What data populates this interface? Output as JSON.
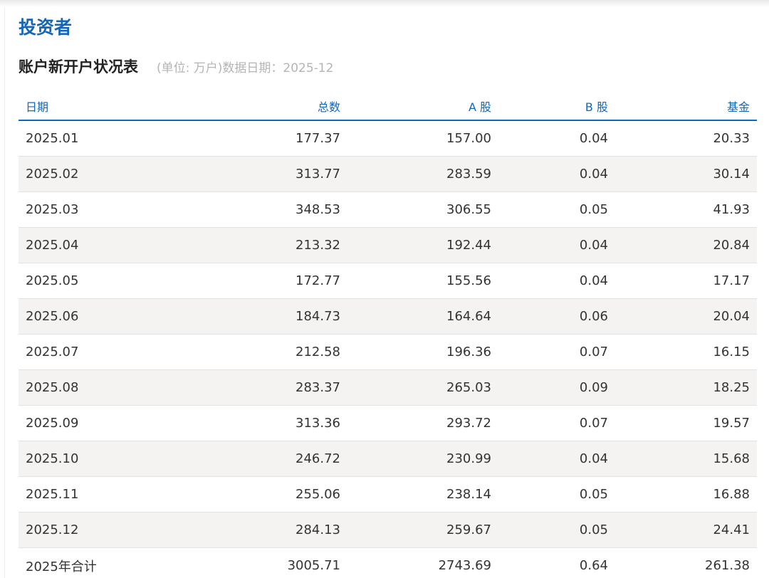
{
  "section": {
    "title": "投资者"
  },
  "table": {
    "name": "账户新开户状况表",
    "unit_note": "(单位: 万户)数据日期：2025-12",
    "headers": {
      "date": "日期",
      "total": "总数",
      "a_share": "A 股",
      "b_share": "B 股",
      "fund": "基金"
    },
    "rows": [
      {
        "date": "2025.01",
        "total": "177.37",
        "a_share": "157.00",
        "b_share": "0.04",
        "fund": "20.33"
      },
      {
        "date": "2025.02",
        "total": "313.77",
        "a_share": "283.59",
        "b_share": "0.04",
        "fund": "30.14"
      },
      {
        "date": "2025.03",
        "total": "348.53",
        "a_share": "306.55",
        "b_share": "0.05",
        "fund": "41.93"
      },
      {
        "date": "2025.04",
        "total": "213.32",
        "a_share": "192.44",
        "b_share": "0.04",
        "fund": "20.84"
      },
      {
        "date": "2025.05",
        "total": "172.77",
        "a_share": "155.56",
        "b_share": "0.04",
        "fund": "17.17"
      },
      {
        "date": "2025.06",
        "total": "184.73",
        "a_share": "164.64",
        "b_share": "0.06",
        "fund": "20.04"
      },
      {
        "date": "2025.07",
        "total": "212.58",
        "a_share": "196.36",
        "b_share": "0.07",
        "fund": "16.15"
      },
      {
        "date": "2025.08",
        "total": "283.37",
        "a_share": "265.03",
        "b_share": "0.09",
        "fund": "18.25"
      },
      {
        "date": "2025.09",
        "total": "313.36",
        "a_share": "293.72",
        "b_share": "0.07",
        "fund": "19.57"
      },
      {
        "date": "2025.10",
        "total": "246.72",
        "a_share": "230.99",
        "b_share": "0.04",
        "fund": "15.68"
      },
      {
        "date": "2025.11",
        "total": "255.06",
        "a_share": "238.14",
        "b_share": "0.05",
        "fund": "16.88"
      },
      {
        "date": "2025.12",
        "total": "284.13",
        "a_share": "259.67",
        "b_share": "0.05",
        "fund": "24.41"
      },
      {
        "date": "2025年合计",
        "total": "3005.71",
        "a_share": "2743.69",
        "b_share": "0.64",
        "fund": "261.38"
      }
    ]
  },
  "colors": {
    "accent": "#1466b8",
    "heading_text": "#222222",
    "muted_text": "#b4b4b4",
    "body_text": "#333333",
    "stripe": "#f4f3f1"
  }
}
